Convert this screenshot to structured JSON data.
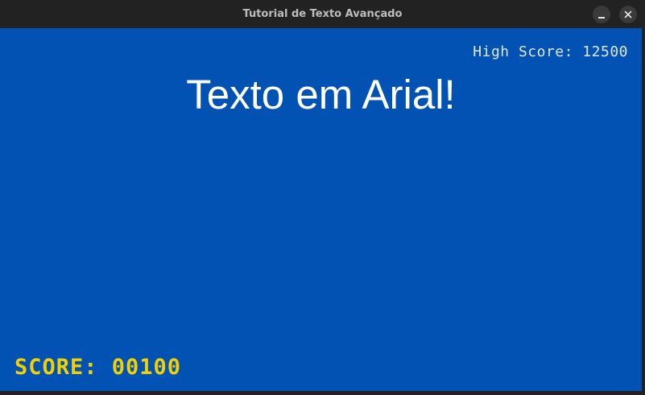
{
  "window": {
    "title": "Tutorial de Texto Avançado",
    "controls": {
      "minimize_icon": "minimize-icon",
      "close_icon": "close-icon"
    }
  },
  "game": {
    "background_color": "#0152B2",
    "heading": "Texto em Arial!",
    "high_score": "High Score: 12500",
    "score": "SCORE: 00100",
    "score_color": "#F3D000"
  }
}
